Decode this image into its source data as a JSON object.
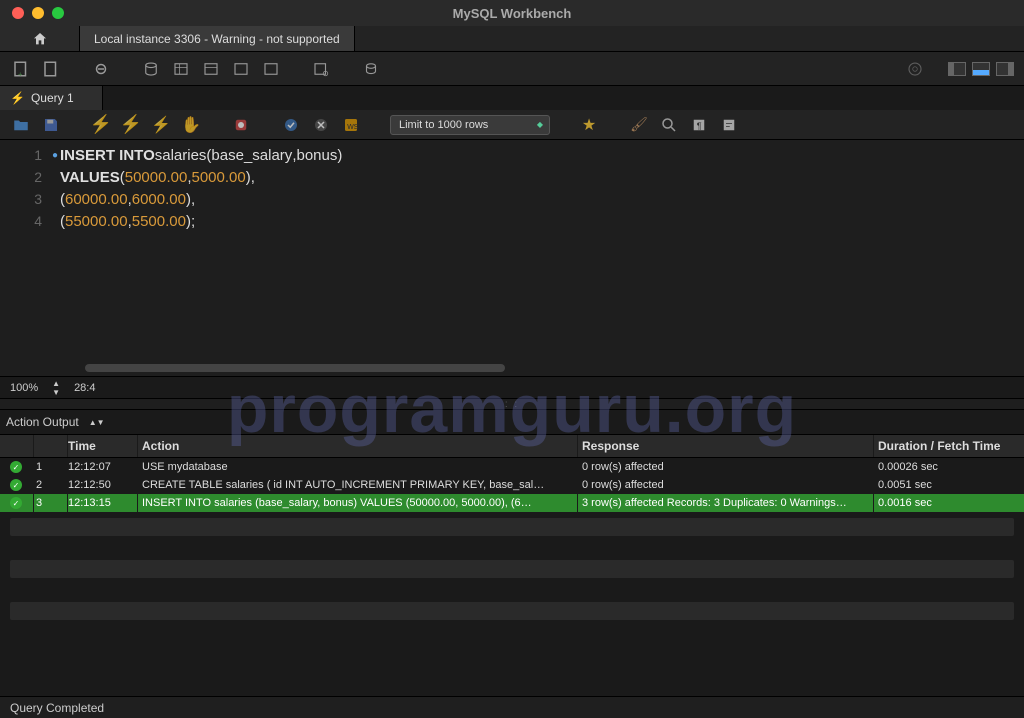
{
  "window": {
    "title": "MySQL Workbench"
  },
  "connection_tab": "Local instance 3306 - Warning - not supported",
  "query_tab": "Query 1",
  "limit_label": "Limit to 1000 rows",
  "zoom": "100%",
  "cursor": "28:4",
  "editor": {
    "lines": [
      {
        "n": "1",
        "html": "<span class='kw'>INSERT INTO</span> <span class='ident'>salaries</span> <span class='punct'>(</span><span class='ident'>base_salary</span><span class='punct'>,</span> <span class='ident'>bonus</span><span class='punct'>)</span>"
      },
      {
        "n": "2",
        "html": "<span class='kw'>VALUES</span> <span class='punct'>(</span><span class='num'>50000.00</span><span class='punct'>,</span> <span class='num'>5000.00</span><span class='punct'>),</span>"
      },
      {
        "n": "3",
        "html": "       <span class='punct'>(</span><span class='num'>60000.00</span><span class='punct'>,</span> <span class='num'>6000.00</span><span class='punct'>),</span>"
      },
      {
        "n": "4",
        "html": "       <span class='punct'>(</span><span class='num'>55000.00</span><span class='punct'>,</span> <span class='num'>5500.00</span><span class='punct'>);</span>"
      }
    ]
  },
  "output": {
    "panel_label": "Action Output",
    "cols": {
      "time": "Time",
      "action": "Action",
      "response": "Response",
      "duration": "Duration / Fetch Time"
    },
    "rows": [
      {
        "idx": "1",
        "time": "12:12:07",
        "action": "USE mydatabase",
        "response": "0 row(s) affected",
        "duration": "0.00026 sec",
        "selected": false
      },
      {
        "idx": "2",
        "time": "12:12:50",
        "action": "CREATE TABLE salaries (     id INT AUTO_INCREMENT PRIMARY KEY,     base_sal…",
        "response": "0 row(s) affected",
        "duration": "0.0051 sec",
        "selected": false
      },
      {
        "idx": "3",
        "time": "12:13:15",
        "action": "INSERT INTO salaries (base_salary, bonus) VALUES (50000.00, 5000.00),        (6…",
        "response": "3 row(s) affected Records: 3  Duplicates: 0  Warnings…",
        "duration": "0.0016 sec",
        "selected": true
      }
    ]
  },
  "footer": "Query Completed",
  "watermark": "programguru.org"
}
